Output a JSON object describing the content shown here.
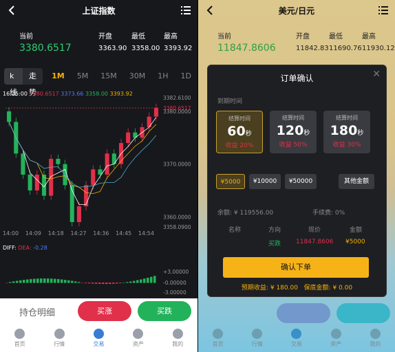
{
  "left": {
    "title": "上证指数",
    "quote": {
      "current_label": "当前",
      "current_value": "3380.6517",
      "open_label": "开盘",
      "open_value": "3363.90",
      "low_label": "最低",
      "low_value": "3358.00",
      "high_label": "最高",
      "high_value": "3393.92"
    },
    "tabs": [
      "k线",
      "走势",
      "1M",
      "5M",
      "15M",
      "30M",
      "1H",
      "1D"
    ],
    "active_tab": "1M",
    "legend": [
      "16:25:00",
      "3380.6517",
      "3373.66",
      "3358.00",
      "3393.92"
    ],
    "y_ticks": [
      "3382.6100",
      "3380.6517",
      "3380.0000",
      "3370.0000",
      "3360.0000",
      "3358.0900"
    ],
    "x_ticks": [
      "14:00",
      "14:09",
      "14:18",
      "14:27",
      "14:36",
      "14:45",
      "14:54"
    ],
    "diff_label": "DIFF:",
    "dea_label": "DEA:",
    "macd_value": "-0.28",
    "macd_ticks": [
      "+3.00000",
      "-0.00000",
      "-3.00000"
    ],
    "hold_label": "持仓明细",
    "buy_up_label": "买涨",
    "buy_down_label": "买跌",
    "tabbar": [
      "首页",
      "行情",
      "交易",
      "资产",
      "我的"
    ]
  },
  "right": {
    "title": "美元/日元",
    "quote": {
      "current_label": "当前",
      "current_value": "11847.8606",
      "open_label": "开盘",
      "open_value": "11842.83",
      "low_label": "最低",
      "low_value": "11690.76",
      "high_label": "最高",
      "high_value": "11930.12"
    },
    "modal": {
      "title": "订单确认",
      "expiry_label": "到期时间",
      "options": [
        {
          "label": "结算时间",
          "value": "60",
          "unit": "秒",
          "profit": "收益 20%"
        },
        {
          "label": "结算时间",
          "value": "120",
          "unit": "秒",
          "profit": "收益 50%"
        },
        {
          "label": "结算时间",
          "value": "180",
          "unit": "秒",
          "profit": "收益 30%"
        }
      ],
      "amounts": [
        "¥5000",
        "¥10000",
        "¥50000",
        "其他金额"
      ],
      "balance": "余额: ¥ 119556.00",
      "fee": "手续费: 0%",
      "headers": [
        "名称",
        "方向",
        "现价",
        "金额"
      ],
      "row": {
        "name": "",
        "direction": "买跌",
        "price": "11847.8606",
        "amount": "¥5000"
      },
      "confirm_label": "确认下单",
      "expected_profit_label": "预期收益:",
      "expected_profit_value": "¥ 180.00",
      "margin_label": "保底金额:",
      "margin_value": "¥ 0.00"
    },
    "tabbar": [
      "首页",
      "行情",
      "交易",
      "资产",
      "我的"
    ]
  },
  "colors": {
    "up": "#e0304a",
    "down": "#22b35a",
    "accent": "#f6b100",
    "panel": "#17181c"
  },
  "chart_data": {
    "type": "candlestick",
    "title": "",
    "x_ticks": [
      "14:00",
      "14:09",
      "14:18",
      "14:27",
      "14:36",
      "14:45",
      "14:54"
    ],
    "ylim": [
      3358.09,
      3382.61
    ],
    "closes": [
      3378,
      3372,
      3368,
      3365,
      3368,
      3364,
      3371,
      3370,
      3366,
      3359,
      3362,
      3366,
      3369,
      3368,
      3372,
      3370,
      3374,
      3376,
      3375,
      3377,
      3379,
      3380.65
    ]
  }
}
